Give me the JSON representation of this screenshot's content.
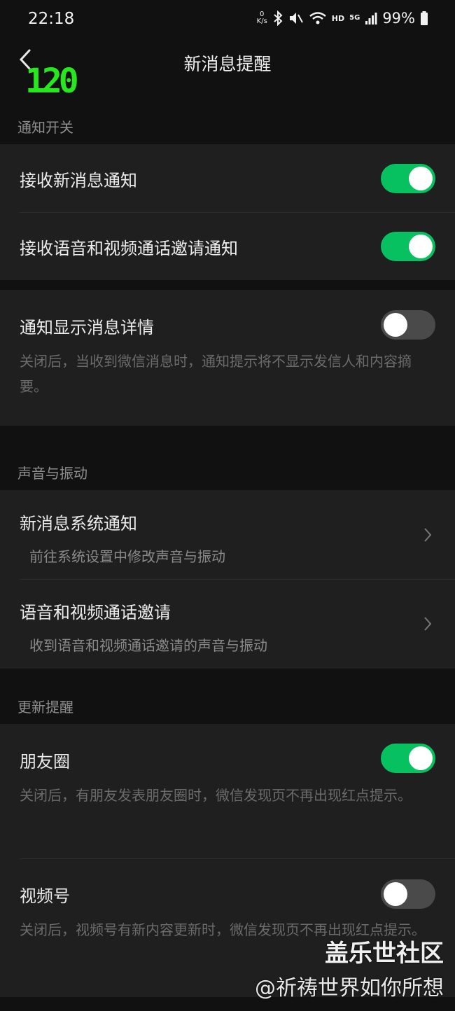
{
  "status": {
    "time": "22:18",
    "net_speed_value": "0",
    "net_speed_unit": "K/s",
    "hd": "HD",
    "network": "5G",
    "battery": "99%"
  },
  "nav": {
    "title": "新消息提醒",
    "fps_overlay": "120"
  },
  "sections": {
    "notify": {
      "header": "通知开关",
      "receive_new": {
        "label": "接收新消息通知",
        "enabled": true
      },
      "receive_call": {
        "label": "接收语音和视频通话邀请通知",
        "enabled": true
      },
      "show_details": {
        "label": "通知显示消息详情",
        "enabled": false,
        "desc": "关闭后，当收到微信消息时，通知提示将不显示发信人和内容摘要。"
      }
    },
    "sound": {
      "header": "声音与振动",
      "system_notify": {
        "label": "新消息系统通知",
        "sub": "前往系统设置中修改声音与振动"
      },
      "call_invite": {
        "label": "语音和视频通话邀请",
        "sub": "收到语音和视频通话邀请的声音与振动"
      }
    },
    "update": {
      "header": "更新提醒",
      "moments": {
        "label": "朋友圈",
        "enabled": true,
        "desc": "关闭后，有朋友发表朋友圈时，微信发现页不再出现红点提示。"
      },
      "channels": {
        "label": "视频号",
        "enabled": false,
        "desc": "关闭后，视频号有新内容更新时，微信发现页不再出现红点提示。"
      }
    }
  },
  "watermark": {
    "brand": "盖乐世社区",
    "user": "@祈祷世界如你所想"
  },
  "colors": {
    "accent_green": "#07c160",
    "background": "#111111",
    "card": "#1f1f1f"
  }
}
